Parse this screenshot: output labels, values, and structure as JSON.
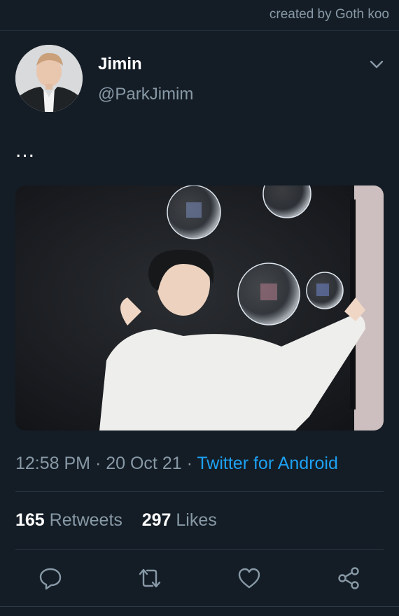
{
  "watermark": "created by Goth koo",
  "tweet": {
    "author_name": "Jimin",
    "author_handle": "@ParkJimim",
    "text": "...",
    "time": "12:58 PM",
    "date": "20 Oct 21",
    "source": "Twitter for Android",
    "separator": " · "
  },
  "stats": {
    "retweets_count": "165",
    "retweets_label": "Retweets",
    "likes_count": "297",
    "likes_label": "Likes"
  },
  "icons": {
    "menu": "chevron-down-icon",
    "reply": "reply-icon",
    "retweet": "retweet-icon",
    "like": "heart-icon",
    "share": "share-icon"
  },
  "colors": {
    "background": "#141d26",
    "secondary_text": "#8899a6",
    "link": "#1da1f2"
  }
}
